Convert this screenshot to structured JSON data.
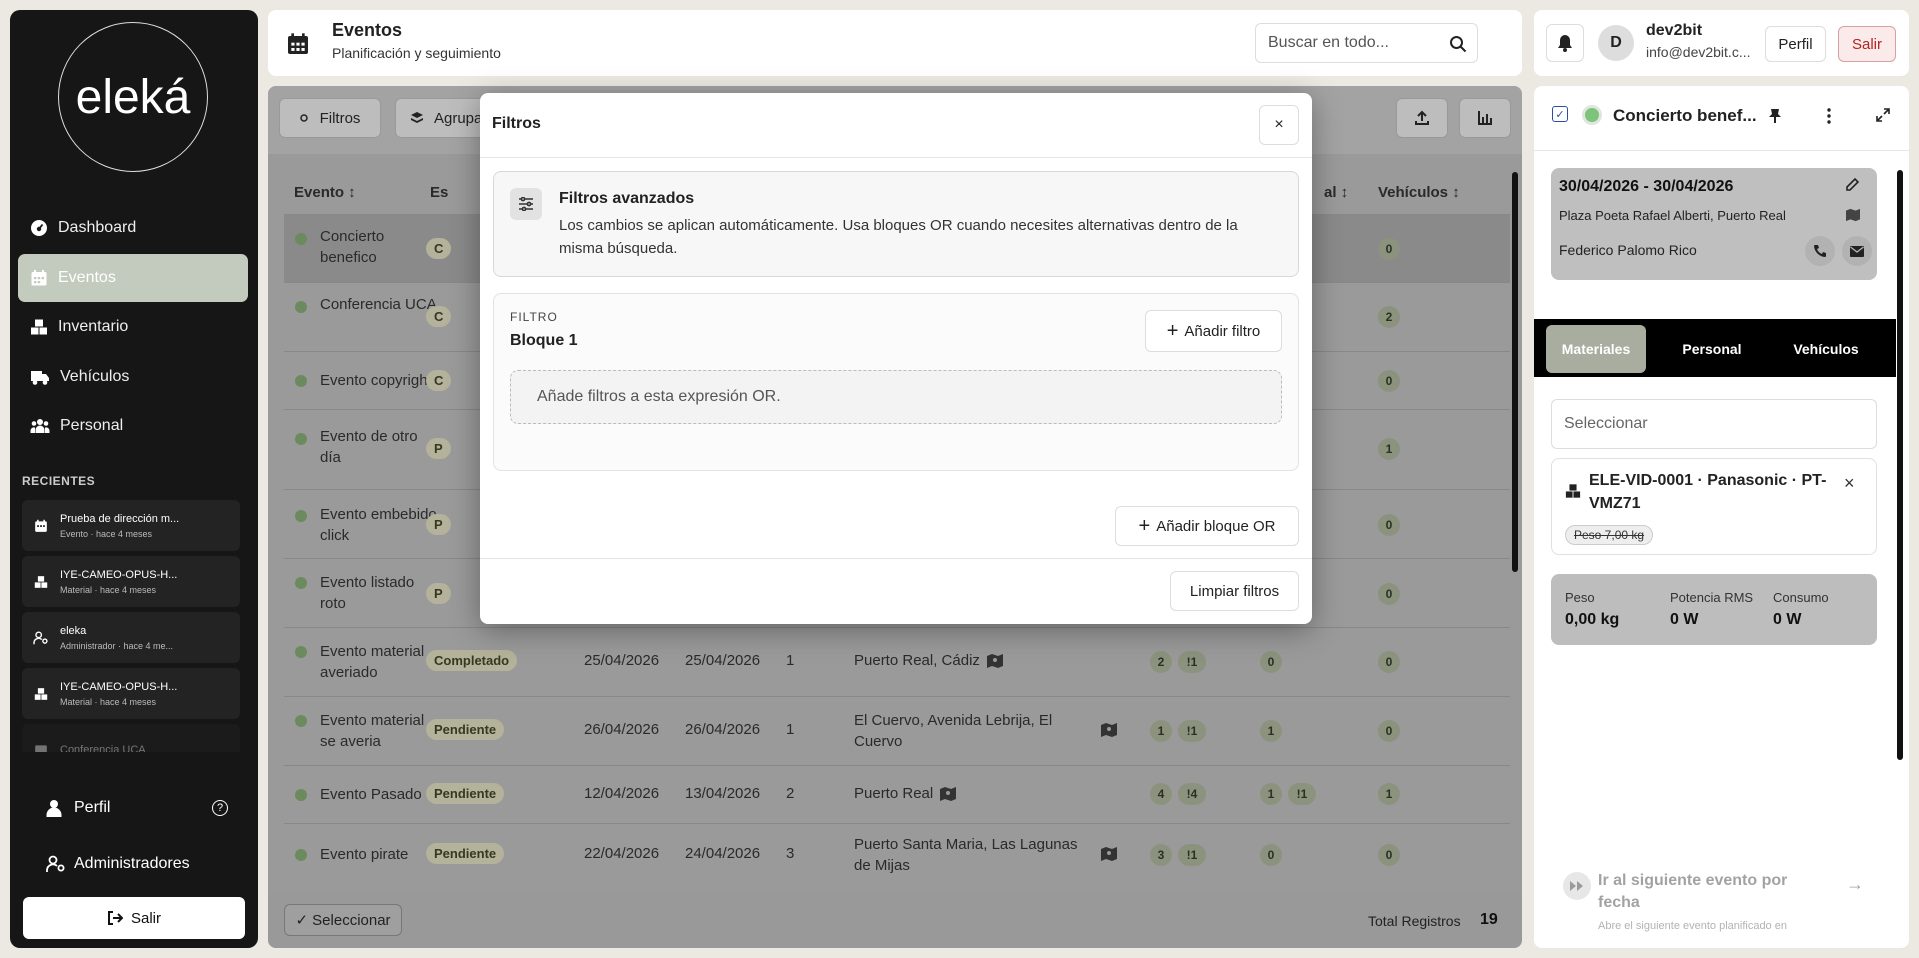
{
  "sidebar": {
    "logo": "eleká",
    "nav": [
      {
        "label": "Dashboard",
        "icon": "dashboard-icon"
      },
      {
        "label": "Eventos",
        "icon": "calendar-icon",
        "active": true
      },
      {
        "label": "Inventario",
        "icon": "boxes-icon"
      },
      {
        "label": "Vehículos",
        "icon": "truck-icon"
      },
      {
        "label": "Personal",
        "icon": "people-icon"
      }
    ],
    "recents_title": "RECIENTES",
    "recents": [
      {
        "title": "Prueba de dirección m...",
        "meta": "Evento · hace 4 meses",
        "icon": "calendar-icon"
      },
      {
        "title": "IYE-CAMEO-OPUS-H...",
        "meta": "Material · hace 4 meses",
        "icon": "boxes-icon"
      },
      {
        "title": "eleka",
        "meta": "Administrador · hace 4 me...",
        "icon": "user-gear-icon"
      },
      {
        "title": "IYE-CAMEO-OPUS-H...",
        "meta": "Material · hace 4 meses",
        "icon": "boxes-icon"
      },
      {
        "title": "Conferencia UCA",
        "meta": "",
        "icon": "calendar-icon"
      }
    ],
    "profile_label": "Perfil",
    "admins_label": "Administradores",
    "logout_label": "Salir"
  },
  "header": {
    "title": "Eventos",
    "subtitle": "Planificación y seguimiento",
    "search_placeholder": "Buscar en todo..."
  },
  "user": {
    "initial": "D",
    "name": "dev2bit",
    "email": "info@dev2bit.c...",
    "profile_btn": "Perfil",
    "logout_btn": "Salir"
  },
  "toolbar": {
    "filters_label": "Filtros",
    "group_label": "Agrupa"
  },
  "table": {
    "headers": {
      "evento": "Evento ↕",
      "estado": "Es",
      "personal": "al ↕",
      "vehiculos": "Vehículos ↕"
    },
    "rows": [
      {
        "evento": "Concierto benefico",
        "estado": "C",
        "vehiculos": "0"
      },
      {
        "evento": "Conferencia UCA",
        "estado": "C",
        "vehiculos": "2"
      },
      {
        "evento": "Evento copyright",
        "estado": "C",
        "vehiculos": "0"
      },
      {
        "evento": "Evento de otro día",
        "estado": "P",
        "vehiculos": "1"
      },
      {
        "evento": "Evento embebido click",
        "estado": "P",
        "vehiculos": "0"
      },
      {
        "evento": "Evento listado roto",
        "estado": "P",
        "vehiculos": "0"
      },
      {
        "evento": "Evento material averiado",
        "estado": "Completado",
        "inicio": "25/04/2026",
        "fin": "25/04/2026",
        "dias": "1",
        "lugar": "Puerto Real, Cádiz",
        "mat": "2",
        "mat_alert": "!1",
        "pers": "0",
        "vehiculos": "0"
      },
      {
        "evento": "Evento material se averia",
        "estado": "Pendiente",
        "inicio": "26/04/2026",
        "fin": "26/04/2026",
        "dias": "1",
        "lugar": "El Cuervo, Avenida Lebrija, El Cuervo",
        "mat": "1",
        "mat_alert": "!1",
        "pers": "1",
        "vehiculos": "0"
      },
      {
        "evento": "Evento Pasado",
        "estado": "Pendiente",
        "inicio": "12/04/2026",
        "fin": "13/04/2026",
        "dias": "2",
        "lugar": "Puerto Real",
        "mat": "4",
        "mat_alert": "!4",
        "pers": "1",
        "pers_alert": "!1",
        "vehiculos": "1"
      },
      {
        "evento": "Evento pirate",
        "estado": "Pendiente",
        "inicio": "22/04/2026",
        "fin": "24/04/2026",
        "dias": "3",
        "lugar": "Puerto Santa Maria, Las Lagunas de Mijas",
        "mat": "3",
        "mat_alert": "!1",
        "pers": "0",
        "vehiculos": "0"
      }
    ],
    "select_label": "✓ Seleccionar",
    "total_label": "Total Registros",
    "total_value": "19"
  },
  "modal": {
    "title": "Filtros",
    "close": "×",
    "adv_title": "Filtros avanzados",
    "adv_text": "Los cambios se aplican automáticamente. Usa bloques OR cuando necesites alternativas dentro de la misma búsqueda.",
    "block_kicker": "FILTRO",
    "block_title": "Bloque 1",
    "add_filter": "Añadir filtro",
    "empty_text": "Añade filtros a esta expresión OR.",
    "add_or": "Añadir bloque OR",
    "clear": "Limpiar filtros"
  },
  "detail": {
    "title": "Concierto benef...",
    "dates": "30/04/2026 - 30/04/2026",
    "place": "Plaza Poeta Rafael Alberti, Puerto Real",
    "contact": "Federico Palomo Rico",
    "tabs": [
      "Materiales",
      "Personal",
      "Vehículos"
    ],
    "select_placeholder": "Seleccionar",
    "item_title": "ELE-VID-0001 · Panasonic · PT-VMZ71",
    "item_badge": "Peso 7,00 kg",
    "stats": [
      {
        "label": "Peso",
        "value": "0,00 kg"
      },
      {
        "label": "Potencia RMS",
        "value": "0 W"
      },
      {
        "label": "Consumo",
        "value": "0 W"
      }
    ],
    "next_title": "Ir al siguiente evento por fecha",
    "next_sub": "Abre el siguiente evento planificado en"
  }
}
